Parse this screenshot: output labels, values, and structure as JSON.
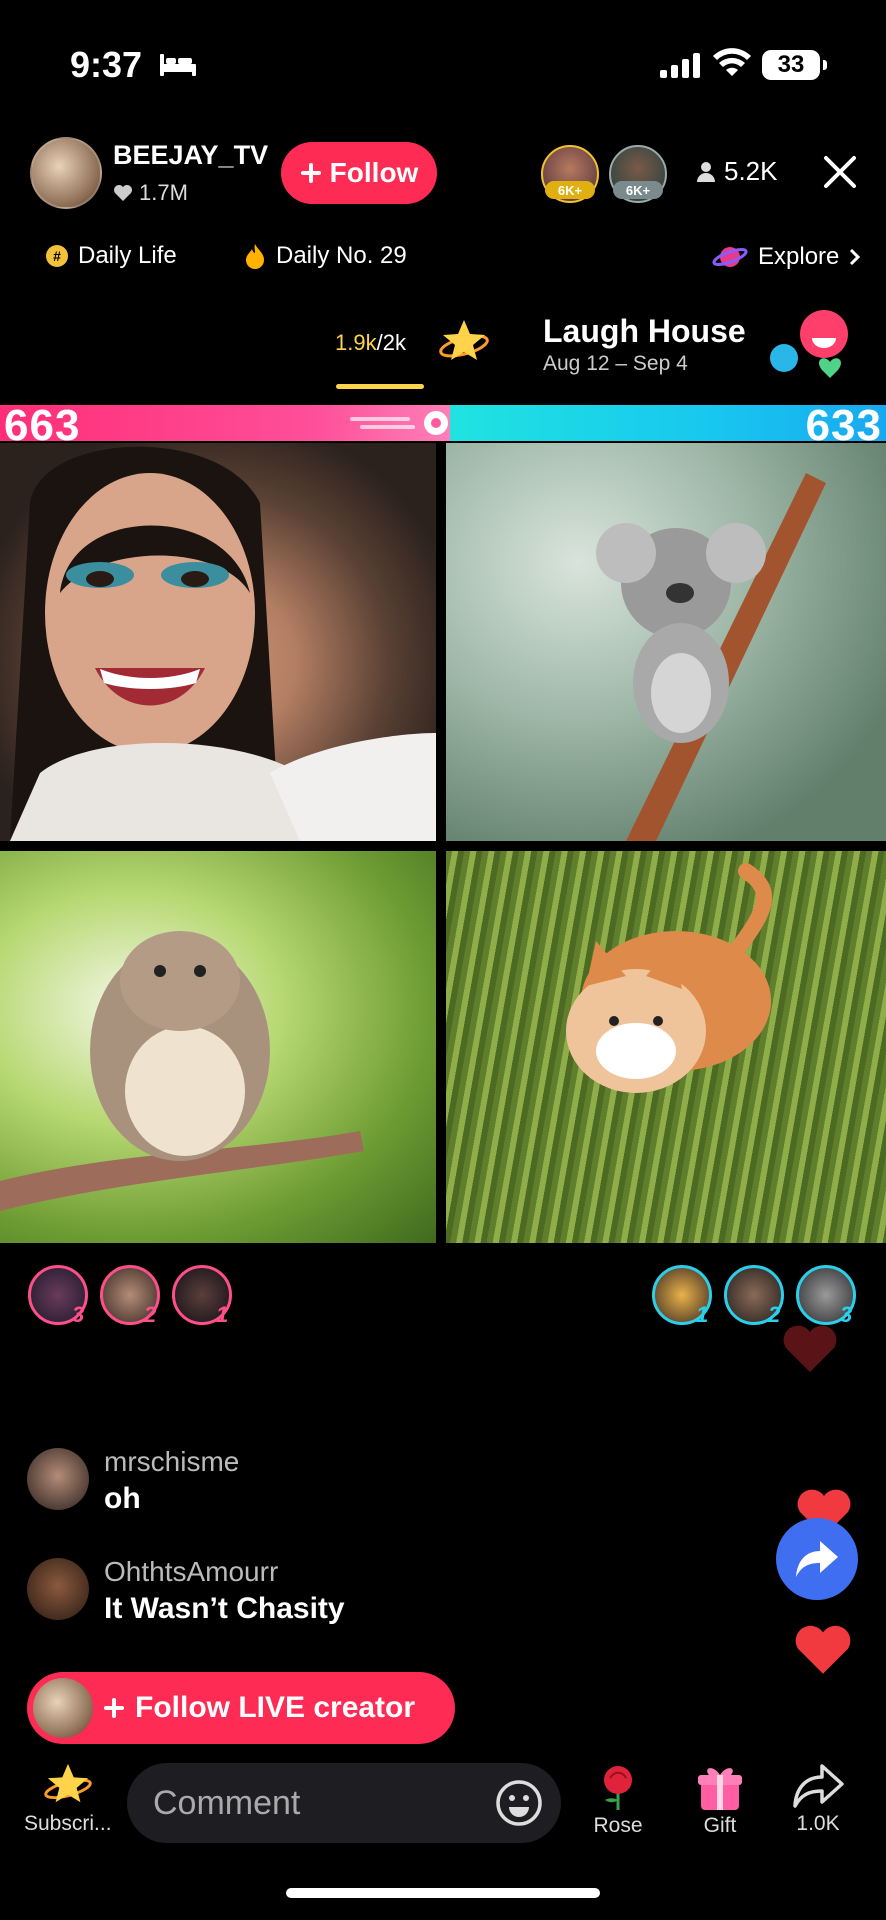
{
  "status_bar": {
    "time": "9:37",
    "battery": "33"
  },
  "header": {
    "host_name": "BEEJAY_TV",
    "host_likes": "1.7M",
    "follow_label": "Follow",
    "top_viewers": [
      {
        "badge": "6K+"
      },
      {
        "badge": "6K+"
      }
    ],
    "viewer_count": "5.2K"
  },
  "chips": {
    "daily_life": "Daily Life",
    "daily_no": "Daily No. 29",
    "explore": "Explore"
  },
  "event": {
    "progress_current": "1.9k",
    "progress_total": "/2k",
    "title": "Laugh House",
    "dates": "Aug 12 – Sep 4"
  },
  "battle": {
    "left_score": "663",
    "right_score": "633"
  },
  "ranks": {
    "left": [
      {
        "num": "3"
      },
      {
        "num": "2"
      },
      {
        "num": "1"
      }
    ],
    "right": [
      {
        "num": "1"
      },
      {
        "num": "2"
      },
      {
        "num": "3"
      }
    ]
  },
  "comments": [
    {
      "user": "mrschisme",
      "text": "oh"
    },
    {
      "user": "OhthtsAmourr",
      "text": "It Wasn’t Chasity"
    }
  ],
  "follow_live_label": "Follow LIVE creator",
  "bottom_bar": {
    "subscribe_label": "Subscri...",
    "comment_placeholder": "Comment",
    "rose_label": "Rose",
    "gift_label": "Gift",
    "share_count": "1.0K"
  },
  "colors": {
    "accent": "#fe2c55",
    "battle_left": "#ff3d8a",
    "battle_right": "#1cc8ef",
    "gold": "#ffd34a",
    "share_fab": "#3f6ff0"
  }
}
